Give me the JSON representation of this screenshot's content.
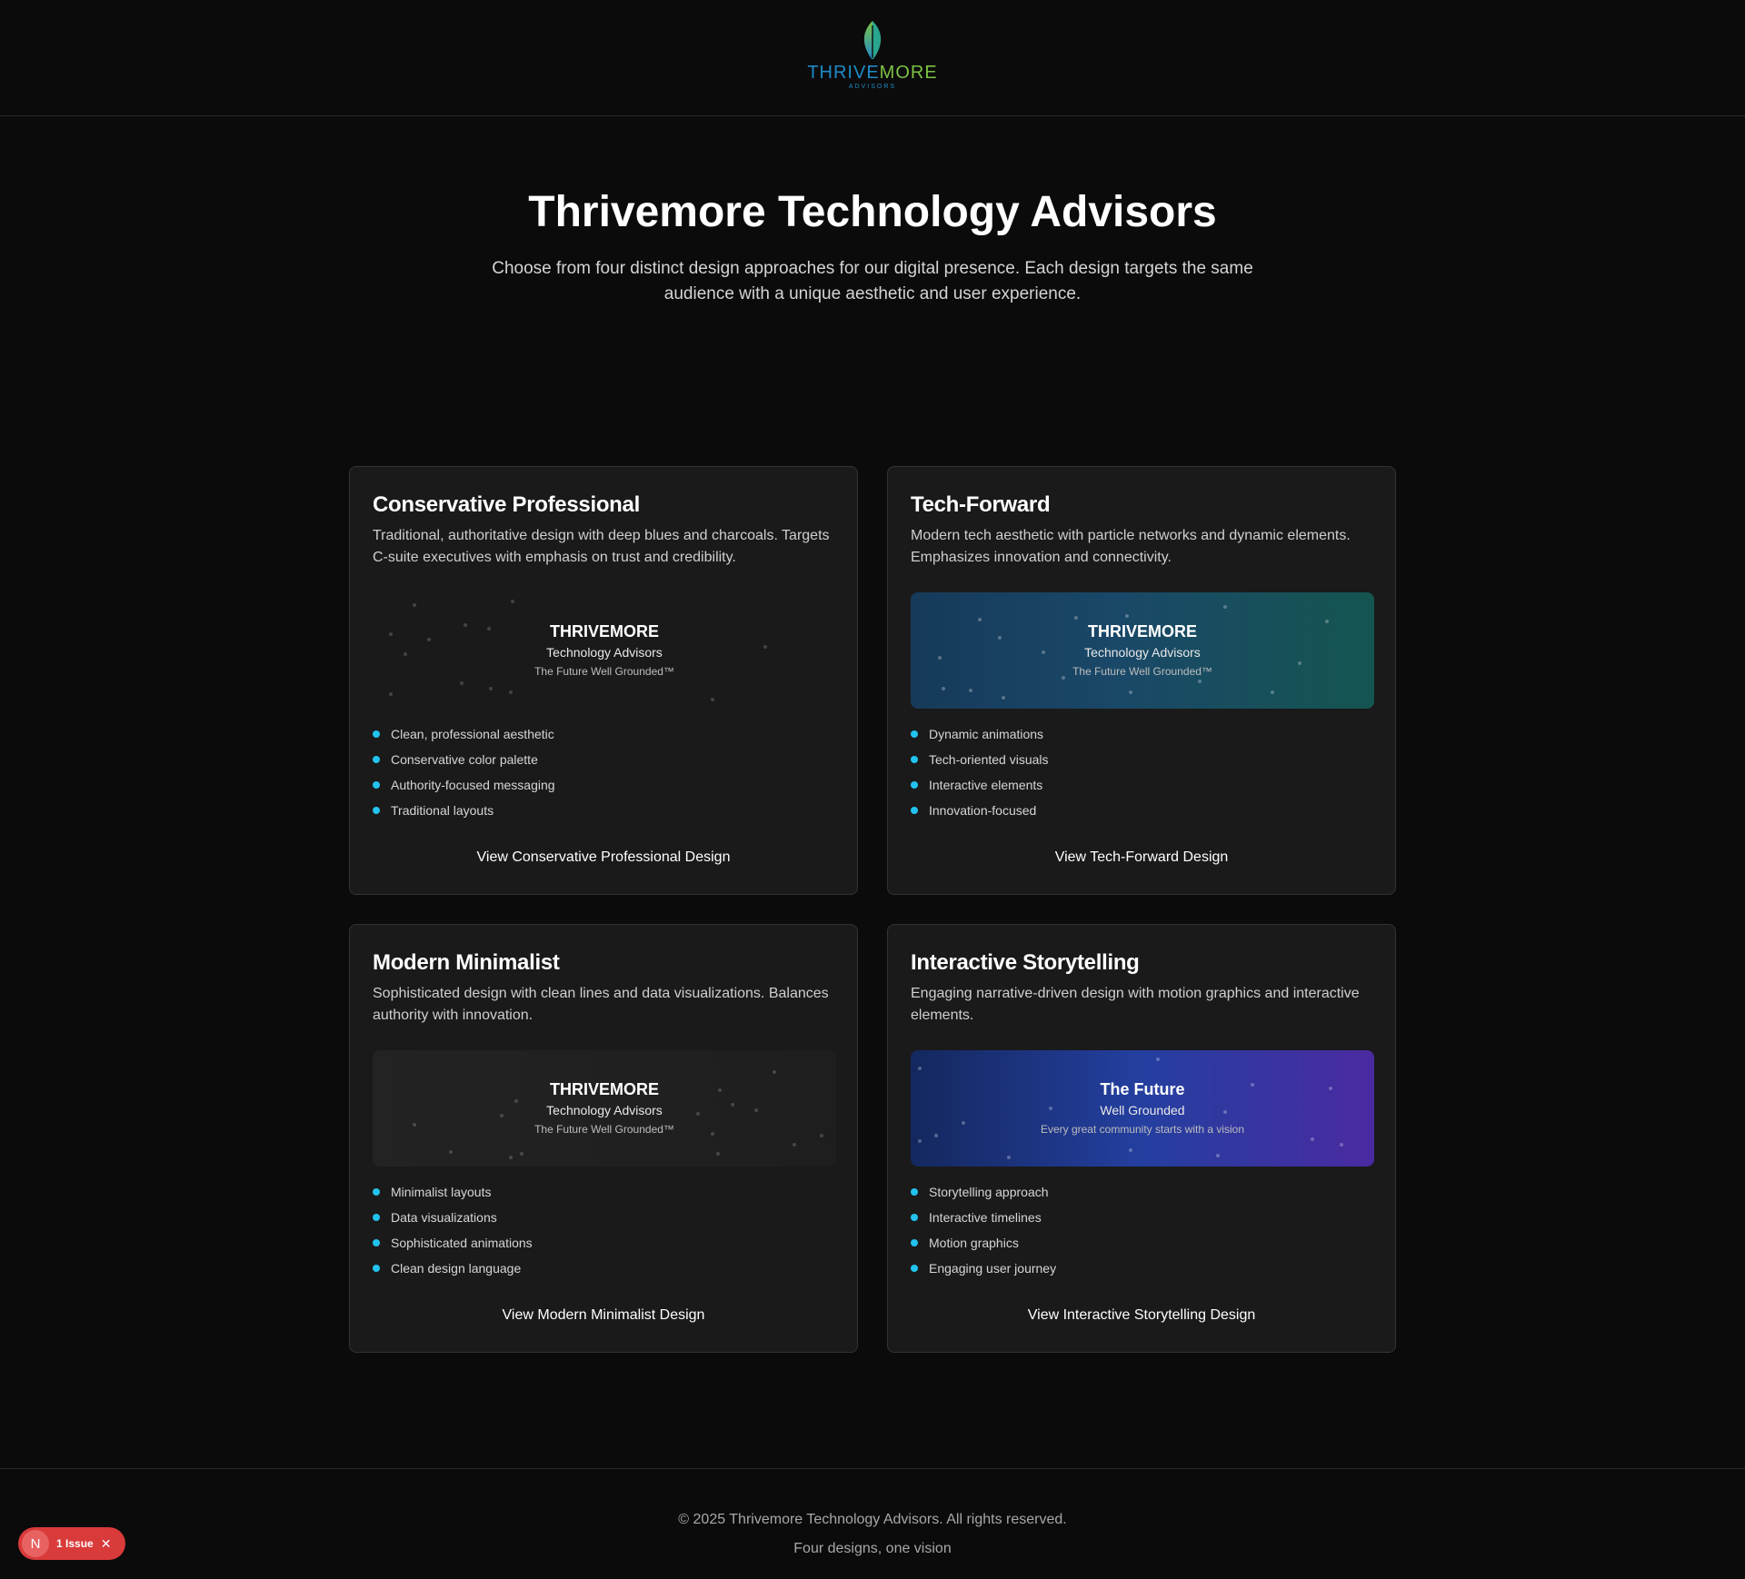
{
  "header": {
    "logo_word_part1": "THRIVE",
    "logo_word_part2": "MORE",
    "logo_subword": "ADVISORS",
    "logo_icon": "leaf-icon"
  },
  "hero": {
    "title": "Thrivemore Technology Advisors",
    "subtitle": "Choose from four distinct design approaches for our digital presence. Each design targets the same audience with a unique aesthetic and user experience."
  },
  "colors": {
    "accent_bullet": "#22c3ee",
    "brand_blue": "#1f8bc9",
    "brand_green": "#7cc243",
    "badge_red": "#d93a3a"
  },
  "cards": [
    {
      "title": "Conservative Professional",
      "description": "Traditional, authoritative design with deep blues and charcoals. Targets C-suite executives with emphasis on trust and credibility.",
      "preview": {
        "title": "THRIVEMORE",
        "subtitle": "Technology Advisors",
        "tagline": "The Future Well Grounded™"
      },
      "features": [
        "Clean, professional aesthetic",
        "Conservative color palette",
        "Authority-focused messaging",
        "Traditional layouts"
      ],
      "link": "View Conservative Professional Design"
    },
    {
      "title": "Tech-Forward",
      "description": "Modern tech aesthetic with particle networks and dynamic elements. Emphasizes innovation and connectivity.",
      "preview": {
        "title": "THRIVEMORE",
        "subtitle": "Technology Advisors",
        "tagline": "The Future Well Grounded™"
      },
      "features": [
        "Dynamic animations",
        "Tech-oriented visuals",
        "Interactive elements",
        "Innovation-focused"
      ],
      "link": "View Tech-Forward Design"
    },
    {
      "title": "Modern Minimalist",
      "description": "Sophisticated design with clean lines and data visualizations. Balances authority with innovation.",
      "preview": {
        "title": "THRIVEMORE",
        "subtitle": "Technology Advisors",
        "tagline": "The Future Well Grounded™"
      },
      "features": [
        "Minimalist layouts",
        "Data visualizations",
        "Sophisticated animations",
        "Clean design language"
      ],
      "link": "View Modern Minimalist Design"
    },
    {
      "title": "Interactive Storytelling",
      "description": "Engaging narrative-driven design with motion graphics and interactive elements.",
      "preview": {
        "title": "The Future",
        "subtitle": "Well Grounded",
        "tagline": "Every great community starts with a vision"
      },
      "features": [
        "Storytelling approach",
        "Interactive timelines",
        "Motion graphics",
        "Engaging user journey"
      ],
      "link": "View Interactive Storytelling Design"
    }
  ],
  "footer": {
    "copyright": "© 2025 Thrivemore Technology Advisors. All rights reserved.",
    "tagline": "Four designs, one vision"
  },
  "issue_badge": {
    "logo_letter": "N",
    "label": "1 Issue",
    "close_glyph": "✕"
  }
}
